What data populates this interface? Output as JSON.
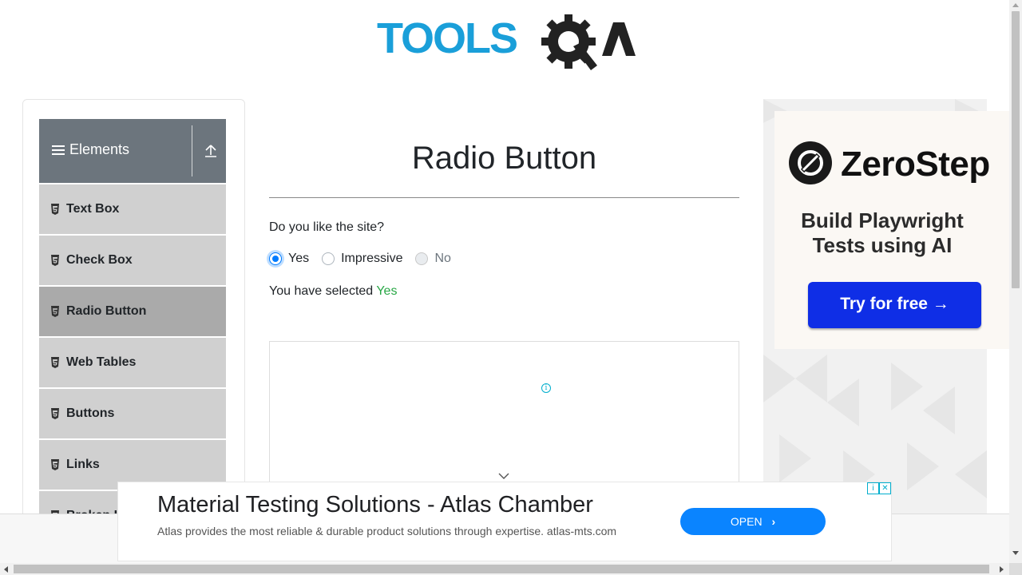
{
  "logo": {
    "text": "TOOLSQA",
    "color_primary": "#1a9fd9",
    "color_dark": "#222222"
  },
  "sidebar": {
    "group_title": "Elements",
    "group_bg": "#6c757d",
    "items": [
      {
        "label": "Text Box",
        "active": false
      },
      {
        "label": "Check Box",
        "active": false
      },
      {
        "label": "Radio Button",
        "active": true
      },
      {
        "label": "Web Tables",
        "active": false
      },
      {
        "label": "Buttons",
        "active": false
      },
      {
        "label": "Links",
        "active": false
      },
      {
        "label": "Broken Links - Images",
        "active": false
      }
    ]
  },
  "main": {
    "title": "Radio Button",
    "question": "Do you like the site?",
    "options": [
      {
        "label": "Yes",
        "checked": true,
        "disabled": false
      },
      {
        "label": "Impressive",
        "checked": false,
        "disabled": false
      },
      {
        "label": "No",
        "checked": false,
        "disabled": true
      }
    ],
    "result_prefix": "You have selected",
    "result_value": "Yes",
    "result_color": "#28a745"
  },
  "right_ad": {
    "brand": "ZeroStep",
    "tagline": "Build Playwright Tests using AI",
    "button": "Try for free →",
    "button_color": "#0f2ee6"
  },
  "bottom_ad": {
    "headline": "Material Testing Solutions - Atlas Chamber",
    "description": "Atlas provides the most reliable & durable product solutions through expertise. atlas-mts.com",
    "button": "OPEN",
    "button_color": "#0a84ff"
  }
}
